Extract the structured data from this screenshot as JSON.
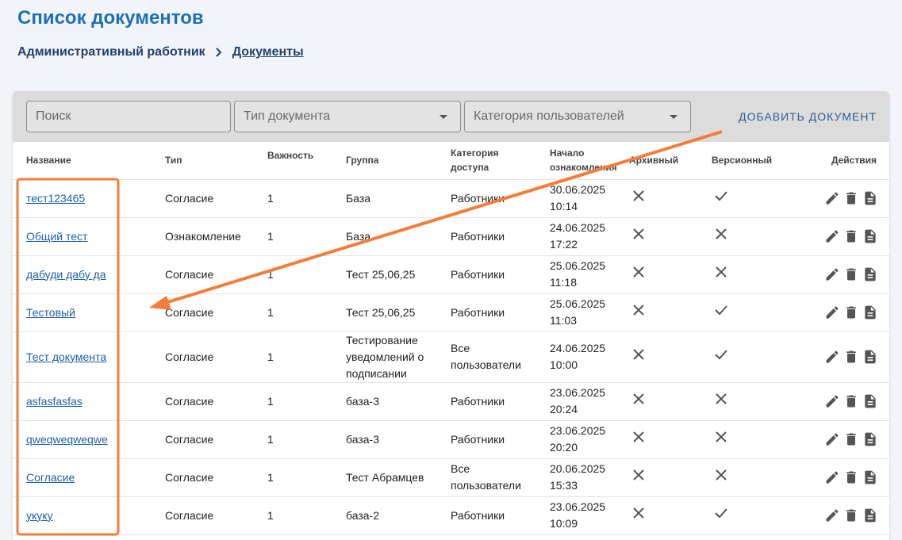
{
  "page": {
    "title": "Список документов"
  },
  "breadcrumb": {
    "root": "Административный работник",
    "current": "Документы"
  },
  "toolbar": {
    "search_placeholder": "Поиск",
    "doc_type_placeholder": "Тип документа",
    "user_category_placeholder": "Категория пользователей",
    "add_button": "ДОБАВИТЬ ДОКУМЕНТ"
  },
  "table": {
    "headers": {
      "name": "Название",
      "type": "Тип",
      "importance": "Важность",
      "group": "Группа",
      "access": "Категория доступа",
      "start": "Начало ознакомления",
      "archive": "Архивный",
      "versioned": "Версионный",
      "actions": "Действия"
    },
    "rows": [
      {
        "name": "тест123465",
        "type": "Согласие",
        "importance": "1",
        "group": "База",
        "access": "Работники",
        "date": "30.06.2025",
        "time": "10:14",
        "archive": "cross",
        "versioned": "check"
      },
      {
        "name": "Общий тест",
        "type": "Ознакомление",
        "importance": "1",
        "group": "База",
        "access": "Работники",
        "date": "24.06.2025",
        "time": "17:22",
        "archive": "cross",
        "versioned": "cross"
      },
      {
        "name": "дабуди дабу да",
        "type": "Согласие",
        "importance": "1",
        "group": "Тест 25,06,25",
        "access": "Работники",
        "date": "25.06.2025",
        "time": "11:18",
        "archive": "cross",
        "versioned": "cross"
      },
      {
        "name": "Тестовый",
        "type": "Согласие",
        "importance": "1",
        "group": "Тест 25,06,25",
        "access": "Работники",
        "date": "25.06.2025",
        "time": "11:03",
        "archive": "cross",
        "versioned": "check"
      },
      {
        "name": "Тест документа",
        "type": "Согласие",
        "importance": "1",
        "group": "Тестирование уведомлений о подписании",
        "access": "Все пользователи",
        "date": "24.06.2025",
        "time": "10:00",
        "archive": "cross",
        "versioned": "check"
      },
      {
        "name": "asfasfasfas",
        "type": "Согласие",
        "importance": "1",
        "group": "база-3",
        "access": "Работники",
        "date": "23.06.2025",
        "time": "20:24",
        "archive": "cross",
        "versioned": "cross"
      },
      {
        "name": "qweqweqweqwe",
        "type": "Согласие",
        "importance": "1",
        "group": "база-3",
        "access": "Работники",
        "date": "23.06.2025",
        "time": "20:20",
        "archive": "cross",
        "versioned": "cross"
      },
      {
        "name": "Согласие",
        "type": "Согласие",
        "importance": "1",
        "group": "Тест Абрамцев",
        "access": "Все пользователи",
        "date": "20.06.2025",
        "time": "15:33",
        "archive": "cross",
        "versioned": "cross"
      },
      {
        "name": "укуку",
        "type": "Согласие",
        "importance": "1",
        "group": "база-2",
        "access": "Работники",
        "date": "23.06.2025",
        "time": "10:09",
        "archive": "cross",
        "versioned": "check"
      }
    ]
  },
  "icons": {
    "cross": "close-icon",
    "check": "check-icon",
    "edit": "pencil-icon",
    "delete": "trash-icon",
    "document": "document-icon"
  },
  "colors": {
    "title": "#1f6fb5",
    "annotation": "#f47d3a",
    "link": "#1f5fa8"
  }
}
